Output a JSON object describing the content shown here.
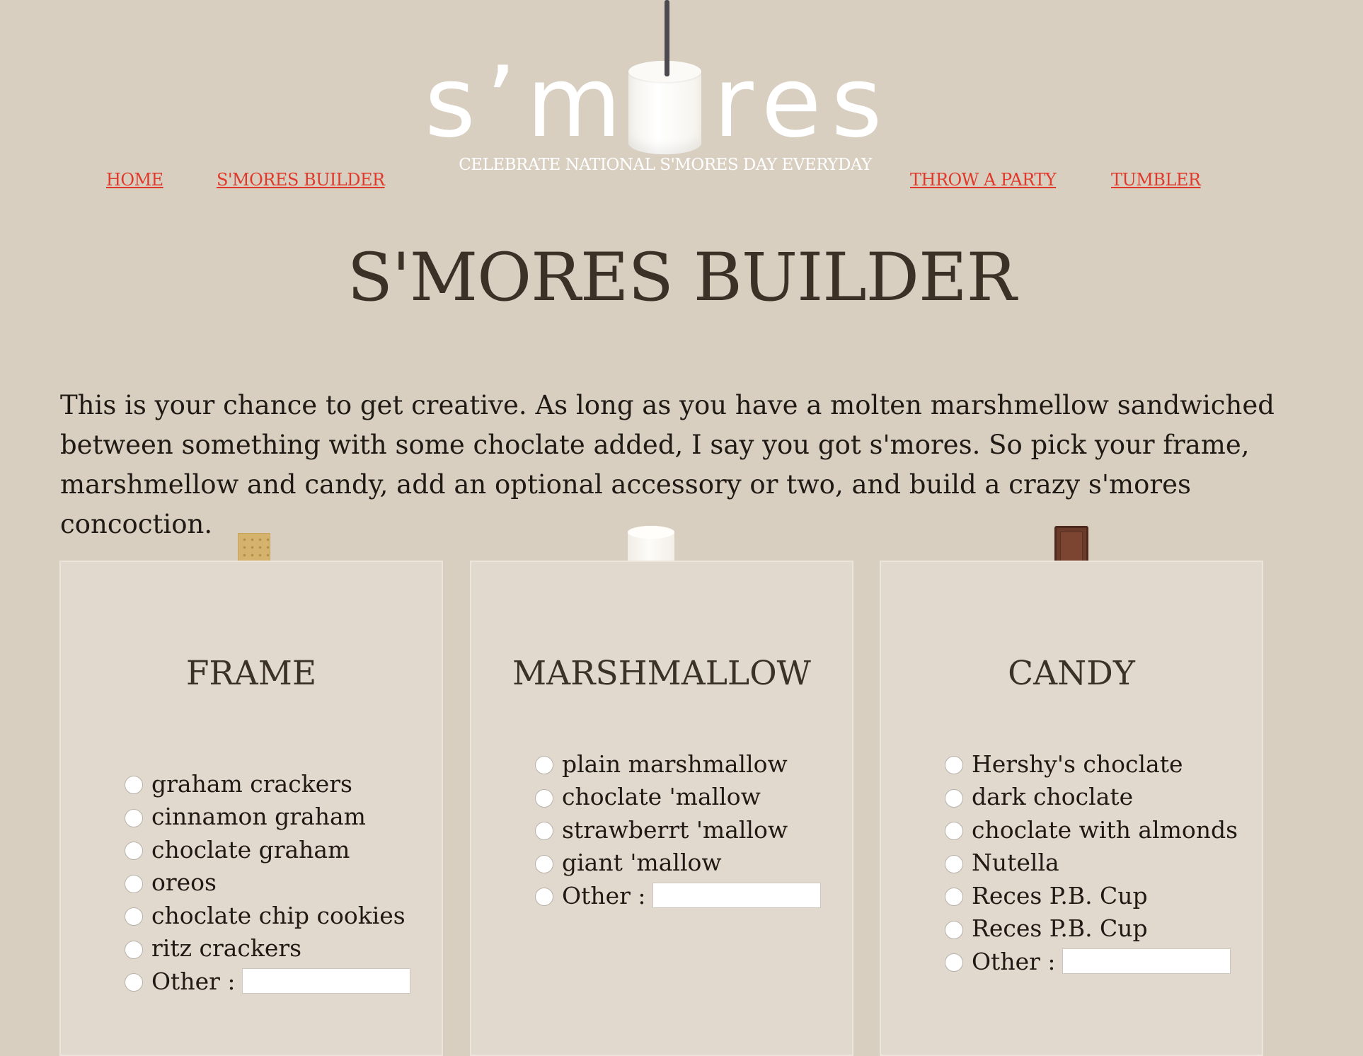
{
  "header": {
    "logo_left": "s’m",
    "logo_right": "res",
    "tagline": "CELEBRATE NATIONAL S'MORES DAY EVERYDAY"
  },
  "nav": {
    "home": "HOME",
    "builder": "S'MORES BUILDER",
    "party": "THROW A PARTY",
    "tumbler": "TUMBLER"
  },
  "page": {
    "title": "S'MORES BUILDER",
    "intro": "This is your chance to get creative. As long as you have a molten marshmellow sandwiched between something with some choclate added, I say you got s'mores. So pick your frame, marshmellow and candy, add an optional accessory or two, and build a crazy s'mores concoction."
  },
  "panels": {
    "frame": {
      "title": "FRAME",
      "options": [
        "graham crackers",
        "cinnamon graham",
        "choclate graham",
        "oreos",
        "choclate chip cookies",
        "ritz crackers"
      ],
      "other_label": "Other :"
    },
    "marshmallow": {
      "title": "MARSHMALLOW",
      "options": [
        "plain marshmallow",
        "choclate 'mallow",
        "strawberrt 'mallow",
        "giant 'mallow"
      ],
      "other_label": "Other :"
    },
    "candy": {
      "title": "CANDY",
      "options": [
        "Hershy's choclate",
        "dark choclate",
        "choclate with almonds",
        "Nutella",
        "Reces P.B. Cup",
        "Reces P.B. Cup"
      ],
      "other_label": "Other :"
    }
  },
  "colors": {
    "background": "#d9cfc1",
    "panel": "#e2d9ce",
    "link": "#e0392b",
    "title": "#3b3126"
  }
}
